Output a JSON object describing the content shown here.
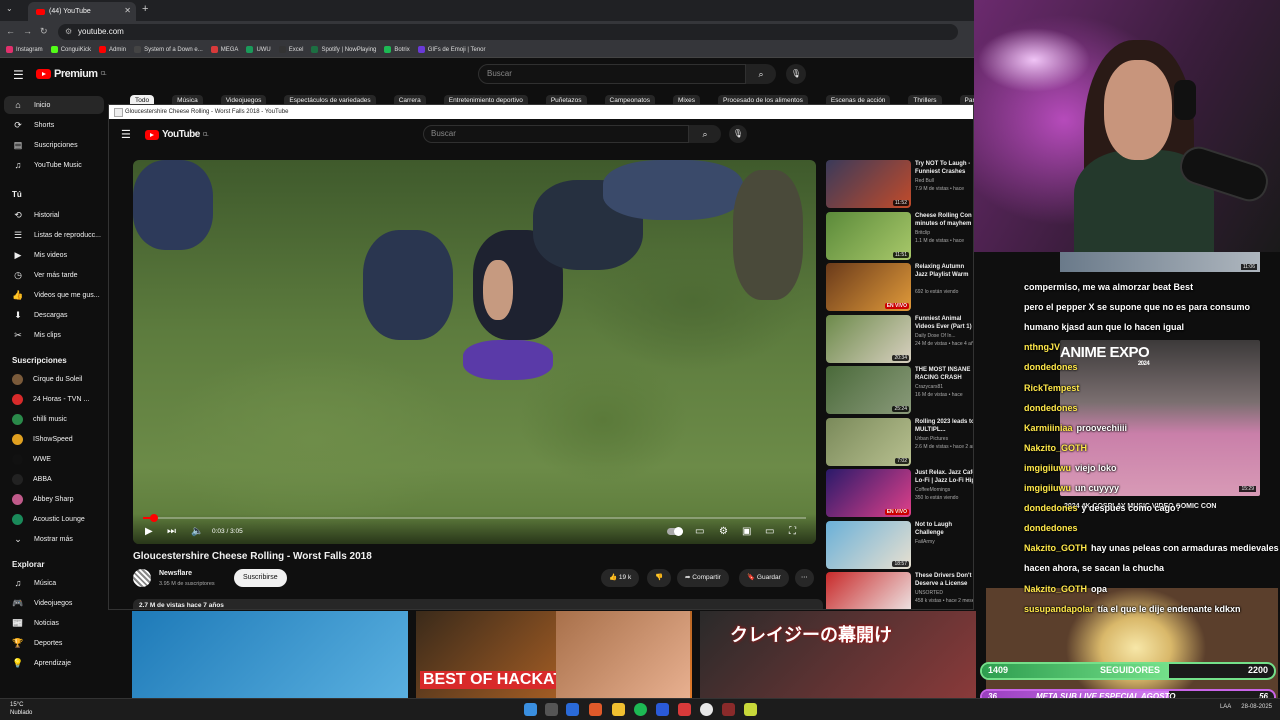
{
  "browser": {
    "tab_title": "(44) YouTube",
    "url": "youtube.com",
    "bookmarks": [
      "Instagram",
      "ConguiKick",
      "Admin",
      "System of a Down e...",
      "MEGA",
      "UWU",
      "Excel",
      "Spotify | NowPlaying",
      "Botrix",
      "GIFs de Emoji | Tenor"
    ]
  },
  "yt": {
    "search_placeholder": "Buscar",
    "logo": "Premium",
    "logo_region": "CL",
    "chips": [
      "Todo",
      "Música",
      "Videojuegos",
      "Espectáculos de variedades",
      "Carrera",
      "Entretenimiento deportivo",
      "Puñetazos",
      "Campeonatos",
      "Mixes",
      "Procesado de los alimentos",
      "Escenas de acción",
      "Thrillers",
      "Parques de atracciones"
    ],
    "sidebar": {
      "main": [
        "Inicio",
        "Shorts",
        "Suscripciones",
        "YouTube Music"
      ],
      "you_header": "Tú",
      "you": [
        "Historial",
        "Listas de reproducc...",
        "Mis videos",
        "Ver más tarde",
        "Videos que me gus...",
        "Descargas",
        "Mis clips"
      ],
      "subs_header": "Suscripciones",
      "subs": [
        "Cirque du Soleil",
        "24 Horas - TVN ...",
        "chilli music",
        "IShowSpeed",
        "WWE",
        "ABBA",
        "Abbey Sharp",
        "Acoustic Lounge",
        "Mostrar más"
      ],
      "explore_header": "Explorar",
      "explore": [
        "Música",
        "Videojuegos",
        "Noticias",
        "Deportes",
        "Aprendizaje"
      ]
    }
  },
  "window": {
    "title": "Gloucestershire Cheese Rolling - Worst Falls 2018 - YouTube",
    "logo": "YouTube",
    "logo_region": "CL",
    "search_placeholder": "Buscar",
    "player": {
      "time": "0:03 / 3:05",
      "progress_fraction": 0.016
    },
    "video_title": "Gloucestershire Cheese Rolling - Worst Falls 2018",
    "channel": "Newsflare",
    "subscribers": "3.95 M de suscriptores",
    "subscribe": "Suscribirse",
    "likes": "19 k",
    "share": "Compartir",
    "save": "Guardar",
    "views": "2.7 M de vistas  hace 7 años",
    "recs": [
      {
        "title": "Try NOT To Laugh - Funniest Crashes",
        "channel": "Red Bull",
        "meta": "7.9 M de vistas • hace",
        "dur": "11:52",
        "colors": [
          "#3a3a5a",
          "#c24b2a"
        ]
      },
      {
        "title": "Cheese Rolling Con minutes of mayhem",
        "channel": "Britclip",
        "meta": "1.1 M de vistas • hace",
        "dur": "11:51",
        "colors": [
          "#5b8a3a",
          "#a8c86a"
        ]
      },
      {
        "title": "Relaxing Autumn Jazz Playlist Warm Outdoor Coffee Sho...",
        "channel": "",
        "meta": "692 lo están viendo",
        "dur": "EN VIVO",
        "colors": [
          "#6a3a1a",
          "#e09a3a"
        ]
      },
      {
        "title": "Funniest Animal Videos Ever (Part 1)",
        "channel": "Daily Dose Of In...",
        "meta": "24 M de vistas • hace 4 años",
        "dur": "20:34",
        "colors": [
          "#6c8a4a",
          "#d8d0c0"
        ]
      },
      {
        "title": "THE MOST INSANE RACING CRASH COMPILATION",
        "channel": "Crazycars81",
        "meta": "16 M de vistas • hace",
        "dur": "25:24",
        "colors": [
          "#4a6a3a",
          "#8a9a7a"
        ]
      },
      {
        "title": "Rolling 2023 leads to MULTIPL...",
        "channel": "Urban Pictures",
        "meta": "2.6 M de vistas • hace 2 años",
        "dur": "7:02",
        "colors": [
          "#7a8a5a",
          "#b8c090"
        ]
      },
      {
        "title": "Just Relax. Jazz Cafe Lo-Fi | Jazz Lo-Fi Hip Hop",
        "channel": "CoffeeMornings",
        "meta": "350 lo están viendo",
        "dur": "EN VIVO",
        "colors": [
          "#2a1a6a",
          "#e0408a"
        ]
      },
      {
        "title": "Not to Laugh Challenge",
        "channel": "FailArmy",
        "meta": "",
        "dur": "18:57",
        "colors": [
          "#6ab0d8",
          "#e8e0d0"
        ]
      },
      {
        "title": "These Drivers Don't Deserve a License",
        "channel": "UNSORTED",
        "meta": "458 k vistas • hace 2 meses",
        "dur": "28:06",
        "colors": [
          "#c82a2a",
          "#f0f0f0"
        ]
      }
    ]
  },
  "bottom_thumbs": [
    {
      "text": "",
      "colors": [
        "#1e7ab8",
        "#5ab0e0"
      ]
    },
    {
      "text": "BEST OF HACKATOOD",
      "colors": [
        "#3a2a1a",
        "#e07a2a"
      ]
    },
    {
      "text": "",
      "colors": [
        "#a8704a",
        "#e8b090"
      ]
    },
    {
      "text": "クレイジーの幕開け",
      "colors": [
        "#2a2a2a",
        "#8a3a3a"
      ]
    }
  ],
  "stream": {
    "chat": [
      {
        "user": "",
        "text": "compermiso, me wa almorzar beat  Best"
      },
      {
        "user": "",
        "text": "pero el pepper X se supone que no es para consumo"
      },
      {
        "user": "",
        "text": "humano kjasd aun que lo hacen igual"
      },
      {
        "user": "nthngJV",
        "text": ""
      },
      {
        "user": "dondedones",
        "text": ""
      },
      {
        "user": "RickTempest",
        "text": ""
      },
      {
        "user": "dondedones",
        "text": ""
      },
      {
        "user": "Karmiiiniaa",
        "text": "proovechiiii"
      },
      {
        "user": "Nakzito_GOTH",
        "text": ""
      },
      {
        "user": "imgigiiuwu",
        "text": "viejo loko"
      },
      {
        "user": "imgigiiuwu",
        "text": "un cuyyyy"
      },
      {
        "user": "dondedones",
        "text": "y despues como cago?"
      },
      {
        "user": "dondedones",
        "text": ""
      },
      {
        "user": "Nakzito_GOTH",
        "text": "hay unas peleas con armaduras medievales que"
      },
      {
        "user": "",
        "text": "hacen ahora, se sacan la chucha"
      },
      {
        "user": "Nakzito_GOTH",
        "text": "opa"
      },
      {
        "user": "susupandapolar",
        "text": "tía el que le dije endenante kdkxn"
      }
    ],
    "mini_dur": "11:06",
    "anime_title": "ANIME EXPO",
    "anime_year": "2024",
    "anime_dur": "15:29",
    "anime_caption": "2024 4K COSPLAY MUSIC VIDEO COMIC CON",
    "followers": {
      "current": "1409",
      "label": "SEGUIDORES",
      "goal": "2200",
      "fraction": 0.64
    },
    "sub_goal": {
      "left": "36",
      "label": "META SUB LIVE ESPECIAL AGOSTO",
      "right": "56",
      "fraction": 0.64
    }
  },
  "taskbar": {
    "temp": "15°C",
    "weather": "Nublado",
    "lang": "LAA",
    "date": "28-08-2025"
  }
}
